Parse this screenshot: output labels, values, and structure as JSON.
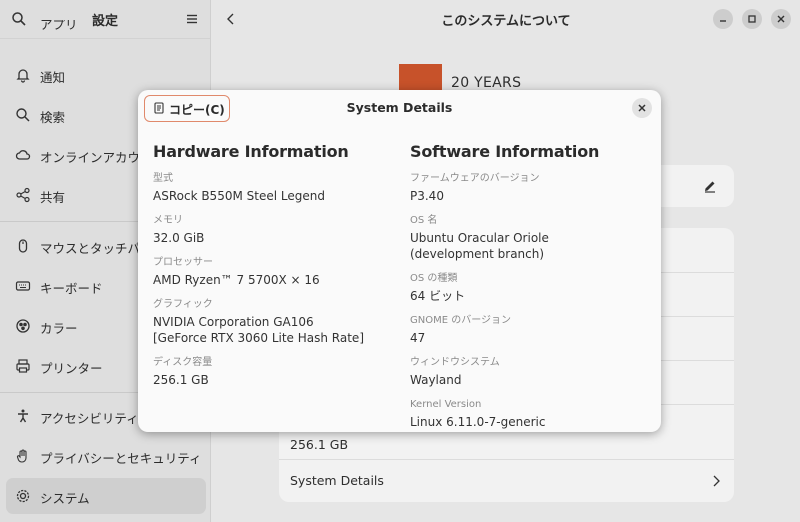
{
  "sidebar": {
    "title": "設定",
    "items": [
      {
        "label": "アプリ",
        "icon": "apps-icon"
      },
      {
        "label": "通知",
        "icon": "bell-icon"
      },
      {
        "label": "検索",
        "icon": "search-icon"
      },
      {
        "label": "オンラインアカウント",
        "icon": "cloud-icon"
      },
      {
        "label": "共有",
        "icon": "share-icon"
      },
      {
        "label": "マウスとタッチパッド",
        "icon": "mouse-icon"
      },
      {
        "label": "キーボード",
        "icon": "keyboard-icon"
      },
      {
        "label": "カラー",
        "icon": "color-icon"
      },
      {
        "label": "プリンター",
        "icon": "printer-icon"
      },
      {
        "label": "アクセシビリティ",
        "icon": "accessibility-icon"
      },
      {
        "label": "プライバシーとセキュリティ",
        "icon": "hand-icon"
      },
      {
        "label": "システム",
        "icon": "system-gear-icon",
        "active": true
      }
    ]
  },
  "main": {
    "title": "このシステムについて",
    "logo_text": "20 YEARS",
    "disk_value": "256.1 GB",
    "system_details_label": "System Details"
  },
  "dialog": {
    "title": "System Details",
    "copy_label": "コピー(C)",
    "hardware": {
      "heading": "Hardware Information",
      "fields": [
        {
          "key": "型式",
          "value": "ASRock B550M Steel Legend"
        },
        {
          "key": "メモリ",
          "value": "32.0 GiB"
        },
        {
          "key": "プロセッサー",
          "value": "AMD Ryzen™ 7 5700X × 16"
        },
        {
          "key": "グラフィック",
          "value": "NVIDIA Corporation GA106",
          "value2": "[GeForce RTX 3060 Lite Hash Rate]"
        },
        {
          "key": "ディスク容量",
          "value": "256.1 GB"
        }
      ]
    },
    "software": {
      "heading": "Software Information",
      "fields": [
        {
          "key": "ファームウェアのバージョン",
          "value": "P3.40"
        },
        {
          "key": "OS 名",
          "value": "Ubuntu Oracular Oriole",
          "value2": "(development branch)"
        },
        {
          "key": "OS の種類",
          "value": "64 ビット"
        },
        {
          "key": "GNOME のバージョン",
          "value": "47"
        },
        {
          "key": "ウィンドウシステム",
          "value": "Wayland"
        },
        {
          "key": "Kernel Version",
          "value": "Linux 6.11.0-7-generic"
        }
      ]
    }
  },
  "colors": {
    "accent": "#e0896b",
    "logo": "#c7522a",
    "sidebar_bg": "#dedede",
    "dialog_bg": "#fafafa"
  }
}
